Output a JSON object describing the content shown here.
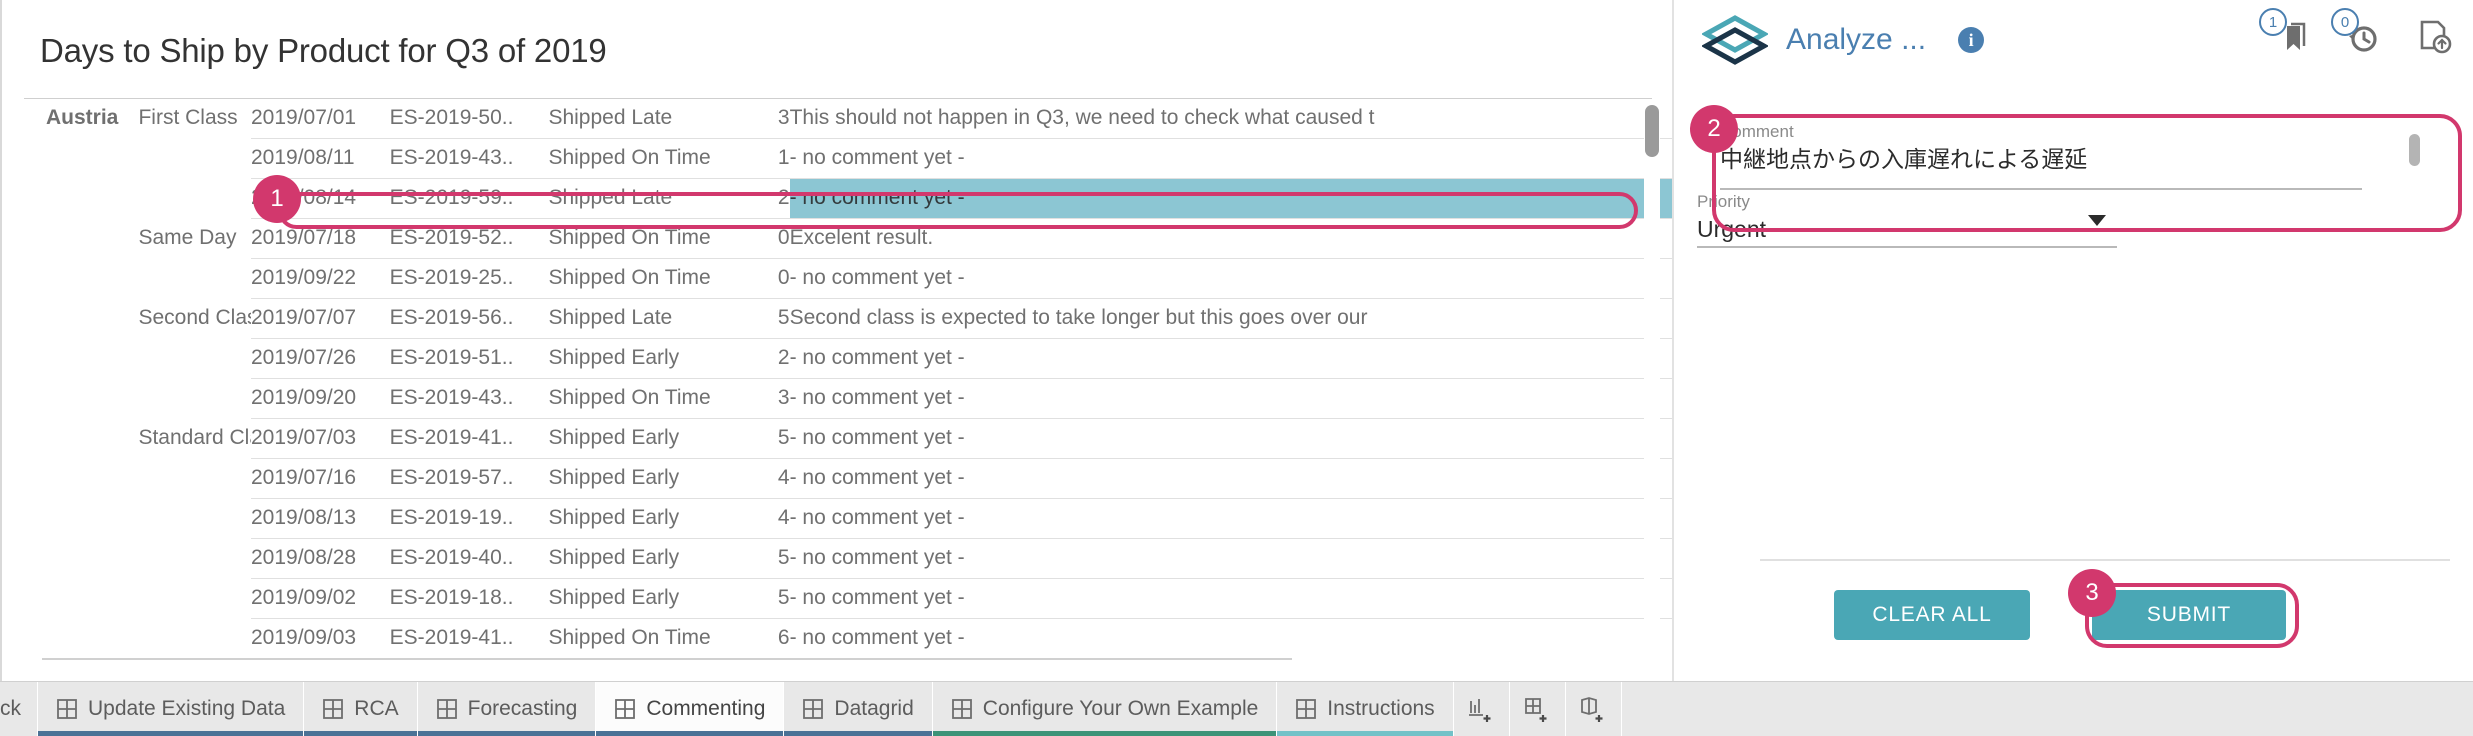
{
  "viz": {
    "title": "Days to Ship by Product for Q3 of 2019",
    "country": "Austria",
    "rows": [
      {
        "ship_mode": "First Class",
        "date": "2019/07/01",
        "order_id": "ES-2019-50..",
        "status": "Shipped Late",
        "days": "3",
        "comment": "This should not happen in Q3, we need to check what caused t",
        "selected": false
      },
      {
        "ship_mode": "",
        "date": "2019/08/11",
        "order_id": "ES-2019-43..",
        "status": "Shipped On Time",
        "days": "1",
        "comment": "- no comment yet -",
        "selected": false
      },
      {
        "ship_mode": "",
        "date": "2019/08/14",
        "order_id": "ES-2019-59..",
        "status": "Shipped Late",
        "days": "2",
        "comment": "- no comment yet -",
        "selected": true
      },
      {
        "ship_mode": "Same Day",
        "date": "2019/07/18",
        "order_id": "ES-2019-52..",
        "status": "Shipped On Time",
        "days": "0",
        "comment": "Excelent result.",
        "selected": false
      },
      {
        "ship_mode": "",
        "date": "2019/09/22",
        "order_id": "ES-2019-25..",
        "status": "Shipped On Time",
        "days": "0",
        "comment": "- no comment yet -",
        "selected": false
      },
      {
        "ship_mode": "Second Class",
        "date": "2019/07/07",
        "order_id": "ES-2019-56..",
        "status": "Shipped Late",
        "days": "5",
        "comment": "Second class is expected to take longer but this goes over our",
        "selected": false
      },
      {
        "ship_mode": "",
        "date": "2019/07/26",
        "order_id": "ES-2019-51..",
        "status": "Shipped Early",
        "days": "2",
        "comment": "- no comment yet -",
        "selected": false
      },
      {
        "ship_mode": "",
        "date": "2019/09/20",
        "order_id": "ES-2019-43..",
        "status": "Shipped On Time",
        "days": "3",
        "comment": "- no comment yet -",
        "selected": false
      },
      {
        "ship_mode": "Standard Class",
        "date": "2019/07/03",
        "order_id": "ES-2019-41..",
        "status": "Shipped Early",
        "days": "5",
        "comment": "- no comment yet -",
        "selected": false
      },
      {
        "ship_mode": "",
        "date": "2019/07/16",
        "order_id": "ES-2019-57..",
        "status": "Shipped Early",
        "days": "4",
        "comment": "- no comment yet -",
        "selected": false
      },
      {
        "ship_mode": "",
        "date": "2019/08/13",
        "order_id": "ES-2019-19..",
        "status": "Shipped Early",
        "days": "4",
        "comment": "- no comment yet -",
        "selected": false
      },
      {
        "ship_mode": "",
        "date": "2019/08/28",
        "order_id": "ES-2019-40..",
        "status": "Shipped Early",
        "days": "5",
        "comment": "- no comment yet -",
        "selected": false
      },
      {
        "ship_mode": "",
        "date": "2019/09/02",
        "order_id": "ES-2019-18..",
        "status": "Shipped Early",
        "days": "5",
        "comment": "- no comment yet -",
        "selected": false
      },
      {
        "ship_mode": "",
        "date": "2019/09/03",
        "order_id": "ES-2019-41..",
        "status": "Shipped On Time",
        "days": "6",
        "comment": "- no comment yet -",
        "selected": false
      }
    ]
  },
  "panel": {
    "brand_title": "Analyze ...",
    "info_icon_label": "i",
    "logo_icon": "stacked-diamonds-logo",
    "icons": [
      {
        "name": "bookmark-icon",
        "badge": "1"
      },
      {
        "name": "history-clock-icon",
        "badge": "0"
      },
      {
        "name": "document-upload-icon",
        "badge": ""
      }
    ],
    "comment_label": "Comment",
    "comment_value": "中継地点からの入庫遅れによる遅延",
    "priority_label": "Priority",
    "priority_value": "Urgent",
    "clear_all_label": "CLEAR ALL",
    "submit_label": "SUBMIT"
  },
  "annotations": [
    {
      "number": "1"
    },
    {
      "number": "2"
    },
    {
      "number": "3"
    }
  ],
  "tabs": [
    {
      "label": "ck",
      "icon": "",
      "active": false,
      "partial": true,
      "underline": ""
    },
    {
      "label": "Update Existing Data",
      "icon": "grid-icon",
      "active": false,
      "partial": false,
      "underline": "#4a7296"
    },
    {
      "label": "RCA",
      "icon": "grid-icon",
      "active": false,
      "partial": false,
      "underline": "#4a7296"
    },
    {
      "label": "Forecasting",
      "icon": "grid-icon",
      "active": false,
      "partial": false,
      "underline": "#4a7296"
    },
    {
      "label": "Commenting",
      "icon": "grid-icon",
      "active": true,
      "partial": false,
      "underline": "#4a7296"
    },
    {
      "label": "Datagrid",
      "icon": "grid-icon",
      "active": false,
      "partial": false,
      "underline": "#4a7296"
    },
    {
      "label": "Configure Your Own Example",
      "icon": "grid-icon",
      "active": false,
      "partial": false,
      "underline": "#3d9378"
    },
    {
      "label": "Instructions",
      "icon": "grid-icon",
      "active": false,
      "partial": false,
      "underline": "#73c2c8"
    }
  ],
  "tab_actions": [
    {
      "name": "new-worksheet-button"
    },
    {
      "name": "new-dashboard-button"
    },
    {
      "name": "new-story-button"
    }
  ],
  "colors": {
    "accent_pink": "#d2386d",
    "teal_button": "#4aa7b5",
    "selection_teal": "#8cc6d3",
    "brand_blue": "#4a7fb0"
  }
}
